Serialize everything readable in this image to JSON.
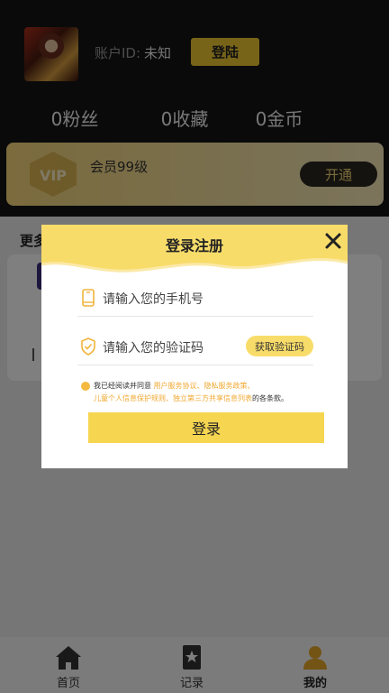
{
  "profile": {
    "account_label": "账户ID:",
    "account_value": "未知",
    "login_button": "登陆"
  },
  "stats": [
    {
      "label": "0粉丝"
    },
    {
      "label": "0收藏"
    },
    {
      "label": "0金币"
    }
  ],
  "vip": {
    "badge": "VIP",
    "level": "会员99级",
    "open_button": "开通"
  },
  "section": {
    "more_title": "更多"
  },
  "tabbar": {
    "items": [
      {
        "label": "首页",
        "icon": "home-icon"
      },
      {
        "label": "记录",
        "icon": "record-icon"
      },
      {
        "label": "我的",
        "icon": "profile-icon",
        "active": true
      }
    ]
  },
  "modal": {
    "title": "登录注册",
    "phone_placeholder": "请输入您的手机号",
    "code_placeholder": "请输入您的验证码",
    "get_code_button": "获取验证码",
    "agreement_prefix": "我已经阅读并同意",
    "agreement_link_1": "用户服务协议、隐私服务政策、",
    "agreement_link_2": "儿童个人信息保护规则、独立第三方共享信息列表",
    "agreement_suffix": "的各条款。",
    "submit_button": "登录"
  },
  "colors": {
    "accent": "#f6d551",
    "link": "#f0a830",
    "header_bg": "#141414"
  }
}
